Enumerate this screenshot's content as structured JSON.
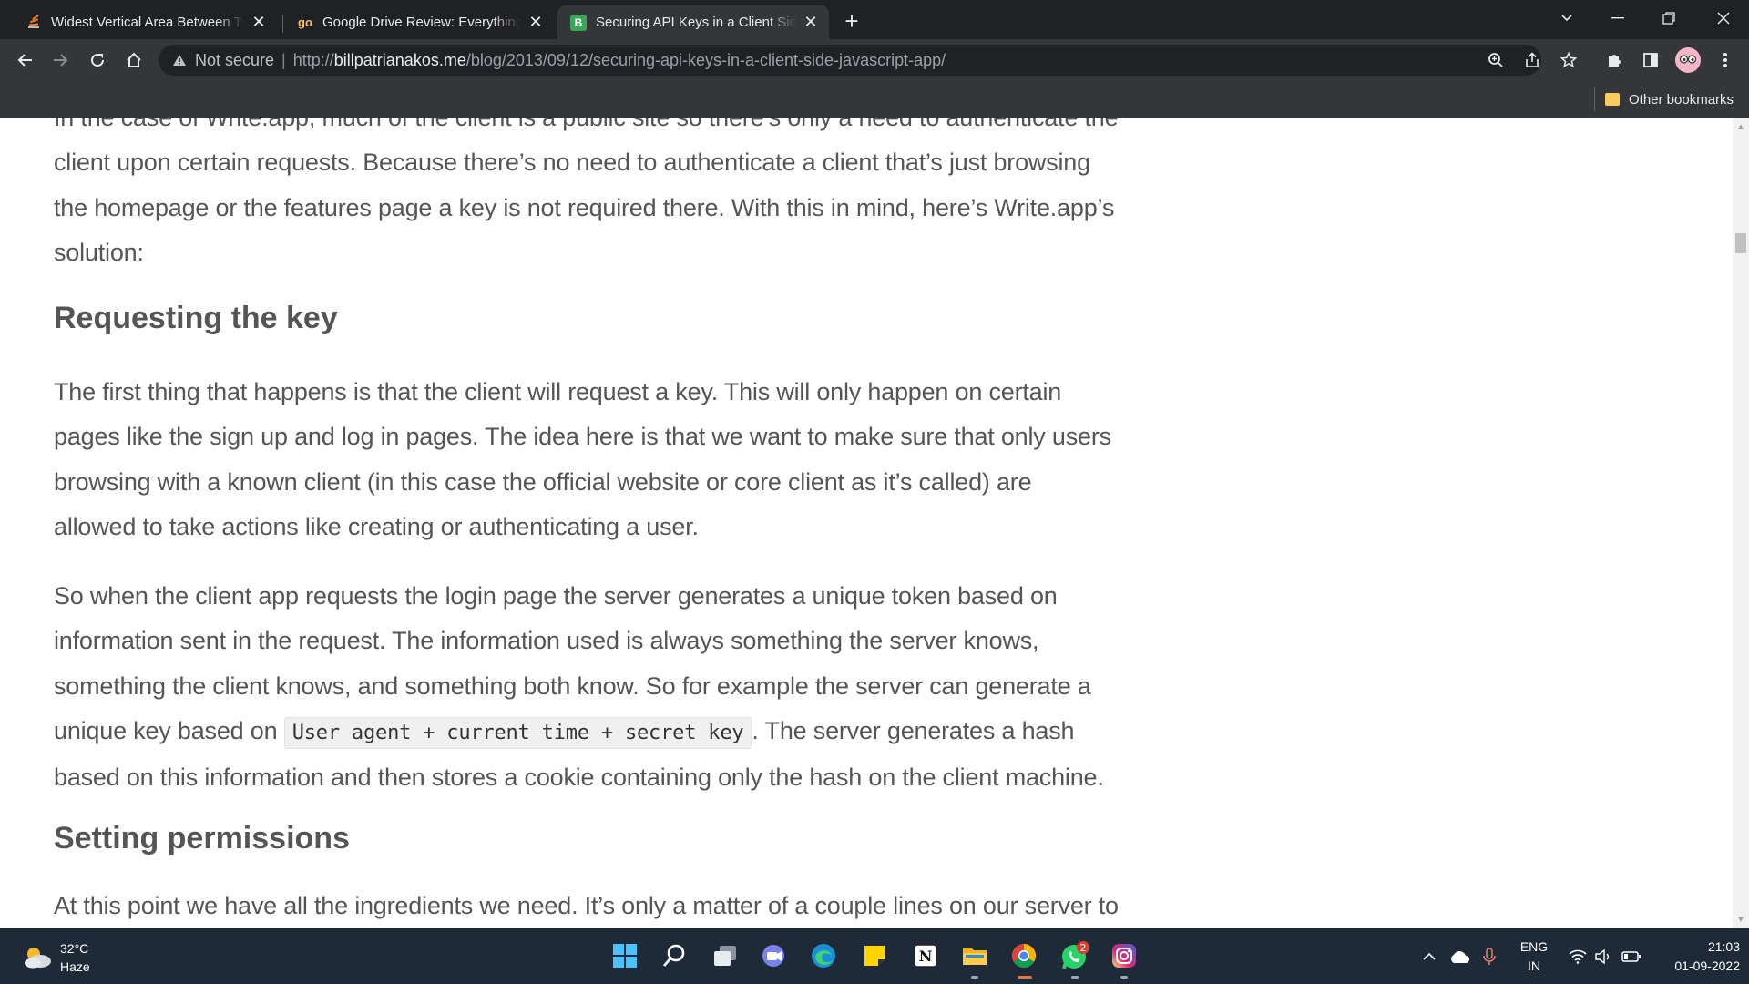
{
  "browser": {
    "tabs": [
      {
        "title": "Widest Vertical Area Between Two Points Containing No Points",
        "favicon": "stack-icon",
        "active": false
      },
      {
        "title": "Google Drive Review: Everything You Need to Know",
        "favicon_text": "go",
        "active": false
      },
      {
        "title": "Securing API Keys in a Client Side JavaScript App",
        "favicon_text": "B",
        "active": true
      }
    ],
    "new_tab": "+",
    "address": {
      "security_label": "Not secure",
      "separator": "|",
      "url_scheme": "http://",
      "url_host": "billpatrianakos.me",
      "url_path": "/blog/2013/09/12/securing-api-keys-in-a-client-side-javascript-app/"
    },
    "bookmarks": {
      "other_label": "Other bookmarks"
    }
  },
  "article": {
    "intro_partial_line": "In the case of Write.app, much of the client is a public site so there’s only a need to authenticate",
    "intro_rest": "the client upon certain requests. Because there’s no need to authenticate a client that’s just browsing the homepage or the features page a key is not required there. With this in mind, here’s Write.app’s solution:",
    "heading_requesting": "Requesting the key",
    "para1": "The first thing that happens is that the client will request a key. This will only happen on certain pages like the sign up and log in pages. The idea here is that we want to make sure that only users browsing with a known client (in this case the official website or core client as it’s called) are allowed to take actions like creating or authenticating a user.",
    "para2_before_code": "So when the client app requests the login page the server generates a unique token based on information sent in the request. The information used is always something the server knows, something the client knows, and something both know. So for example the server can generate a unique key based on ",
    "para2_code": "User agent + current time + secret key",
    "para2_after_code": ". The server generates a hash based on this information and then stores a cookie containing only the hash on the client machine.",
    "heading_permissions": "Setting permissions",
    "next_partial_line": "At this point we have all the ingredients we need. It’s only a matter of a couple lines on our server to lay"
  },
  "taskbar": {
    "weather_temp": "32°C",
    "weather_desc": "Haze",
    "apps": [
      "start-icon",
      "search-icon",
      "task-view-icon",
      "chat-icon",
      "edge-icon",
      "sticky-notes-icon",
      "notion-icon",
      "file-explorer-icon",
      "chrome-icon",
      "whatsapp-icon",
      "instagram-icon"
    ],
    "whatsapp_badge": "2",
    "lang_line1": "ENG",
    "lang_line2": "IN",
    "time": "21:03",
    "date": "01-09-2022"
  },
  "colors": {
    "tabstrip_bg": "#202124",
    "toolbar_bg": "#35363a",
    "article_text": "#555555",
    "taskbar_bg": "#1f2a38"
  }
}
